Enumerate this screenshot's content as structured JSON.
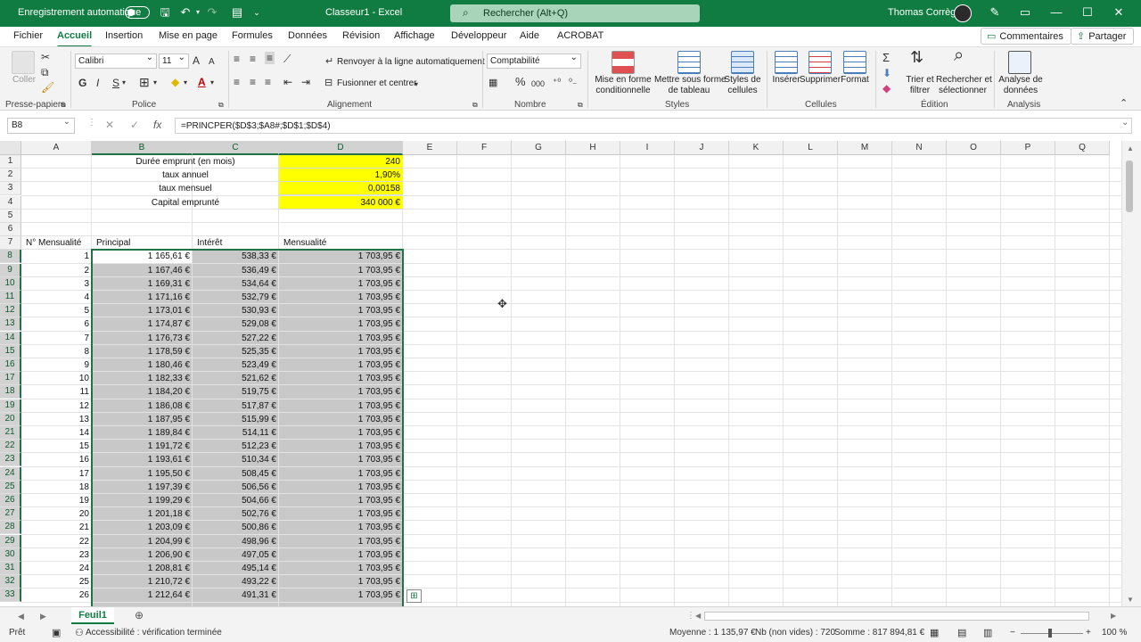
{
  "titlebar": {
    "autosave_label": "Enregistrement automatique",
    "filename": "Classeur1 - Excel",
    "search_placeholder": "Rechercher (Alt+Q)",
    "user_name": "Thomas Corrège"
  },
  "tabs": [
    "Fichier",
    "Accueil",
    "Insertion",
    "Mise en page",
    "Formules",
    "Données",
    "Révision",
    "Affichage",
    "Développeur",
    "Aide",
    "ACROBAT"
  ],
  "active_tab": "Accueil",
  "comments_label": "Commentaires",
  "share_label": "Partager",
  "ribbon": {
    "clipboard": {
      "paste_label": "Coller",
      "group_label": "Presse-papiers"
    },
    "font": {
      "name": "Calibri",
      "size": "11",
      "grow": "A",
      "shrink": "A",
      "bold": "G",
      "italic": "I",
      "underline": "S",
      "group_label": "Police"
    },
    "alignment": {
      "wrap_label": "Renvoyer à la ligne automatiquement",
      "merge_label": "Fusionner et centrer",
      "group_label": "Alignement"
    },
    "number": {
      "format": "Comptabilité",
      "percent": "%",
      "thousands": "000",
      "group_label": "Nombre"
    },
    "styles": {
      "cond_format_1": "Mise en forme",
      "cond_format_2": "conditionnelle",
      "as_table_1": "Mettre sous forme",
      "as_table_2": "de tableau",
      "cell_styles_1": "Styles de",
      "cell_styles_2": "cellules",
      "group_label": "Styles"
    },
    "cells": {
      "insert": "Insérer",
      "delete": "Supprimer",
      "format": "Format",
      "group_label": "Cellules"
    },
    "editing": {
      "sort_1": "Trier et",
      "sort_2": "filtrer",
      "find_1": "Rechercher et",
      "find_2": "sélectionner",
      "group_label": "Édition"
    },
    "analysis": {
      "analyze_1": "Analyse de",
      "analyze_2": "données",
      "group_label": "Analysis"
    }
  },
  "formula_bar": {
    "name_box": "B8",
    "cancel": "✕",
    "enter": "✓",
    "fx": "fx",
    "formula": "=PRINCPER($D$3;$A8#;$D$1;$D$4)"
  },
  "columns": [
    "A",
    "B",
    "C",
    "D",
    "E",
    "F",
    "G",
    "H",
    "I",
    "J",
    "K",
    "L",
    "M",
    "N",
    "O",
    "P",
    "Q"
  ],
  "row_numbers": [
    "1",
    "2",
    "3",
    "4",
    "5",
    "6",
    "7",
    "8",
    "9",
    "10",
    "11",
    "12",
    "13",
    "14",
    "15",
    "16",
    "17",
    "18",
    "19",
    "20",
    "21",
    "22",
    "23",
    "24",
    "25",
    "26",
    "27",
    "28",
    "29",
    "30",
    "31",
    "32",
    "33"
  ],
  "params": [
    {
      "label": "Durée emprunt (en mois)",
      "value": "240"
    },
    {
      "label": "taux annuel",
      "value": "1,90%"
    },
    {
      "label": "taux mensuel",
      "value": "0,00158"
    },
    {
      "label": "Capital emprunté",
      "value": "340 000 €"
    }
  ],
  "headers": {
    "a": "N° Mensualité",
    "b": "Principal",
    "c": "Intérêt",
    "d": "Mensualité"
  },
  "rows": [
    [
      "1",
      "1 165,61 €",
      "538,33 €",
      "1 703,95 €"
    ],
    [
      "2",
      "1 167,46 €",
      "536,49 €",
      "1 703,95 €"
    ],
    [
      "3",
      "1 169,31 €",
      "534,64 €",
      "1 703,95 €"
    ],
    [
      "4",
      "1 171,16 €",
      "532,79 €",
      "1 703,95 €"
    ],
    [
      "5",
      "1 173,01 €",
      "530,93 €",
      "1 703,95 €"
    ],
    [
      "6",
      "1 174,87 €",
      "529,08 €",
      "1 703,95 €"
    ],
    [
      "7",
      "1 176,73 €",
      "527,22 €",
      "1 703,95 €"
    ],
    [
      "8",
      "1 178,59 €",
      "525,35 €",
      "1 703,95 €"
    ],
    [
      "9",
      "1 180,46 €",
      "523,49 €",
      "1 703,95 €"
    ],
    [
      "10",
      "1 182,33 €",
      "521,62 €",
      "1 703,95 €"
    ],
    [
      "11",
      "1 184,20 €",
      "519,75 €",
      "1 703,95 €"
    ],
    [
      "12",
      "1 186,08 €",
      "517,87 €",
      "1 703,95 €"
    ],
    [
      "13",
      "1 187,95 €",
      "515,99 €",
      "1 703,95 €"
    ],
    [
      "14",
      "1 189,84 €",
      "514,11 €",
      "1 703,95 €"
    ],
    [
      "15",
      "1 191,72 €",
      "512,23 €",
      "1 703,95 €"
    ],
    [
      "16",
      "1 193,61 €",
      "510,34 €",
      "1 703,95 €"
    ],
    [
      "17",
      "1 195,50 €",
      "508,45 €",
      "1 703,95 €"
    ],
    [
      "18",
      "1 197,39 €",
      "506,56 €",
      "1 703,95 €"
    ],
    [
      "19",
      "1 199,29 €",
      "504,66 €",
      "1 703,95 €"
    ],
    [
      "20",
      "1 201,18 €",
      "502,76 €",
      "1 703,95 €"
    ],
    [
      "21",
      "1 203,09 €",
      "500,86 €",
      "1 703,95 €"
    ],
    [
      "22",
      "1 204,99 €",
      "498,96 €",
      "1 703,95 €"
    ],
    [
      "23",
      "1 206,90 €",
      "497,05 €",
      "1 703,95 €"
    ],
    [
      "24",
      "1 208,81 €",
      "495,14 €",
      "1 703,95 €"
    ],
    [
      "25",
      "1 210,72 €",
      "493,22 €",
      "1 703,95 €"
    ],
    [
      "26",
      "1 212,64 €",
      "491,31 €",
      "1 703,95 €"
    ]
  ],
  "sheet_tab": "Feuil1",
  "status": {
    "mode": "Prêt",
    "accessibility": "Accessibilité : vérification terminée",
    "average": "Moyenne : 1 135,97 €",
    "count": "Nb (non vides) : 720",
    "sum": "Somme : 817 894,81 €",
    "zoom": "100 %"
  },
  "colors": {
    "excel_green": "#107c41",
    "param_fill": "#ffff00",
    "selection_border": "#217346"
  }
}
